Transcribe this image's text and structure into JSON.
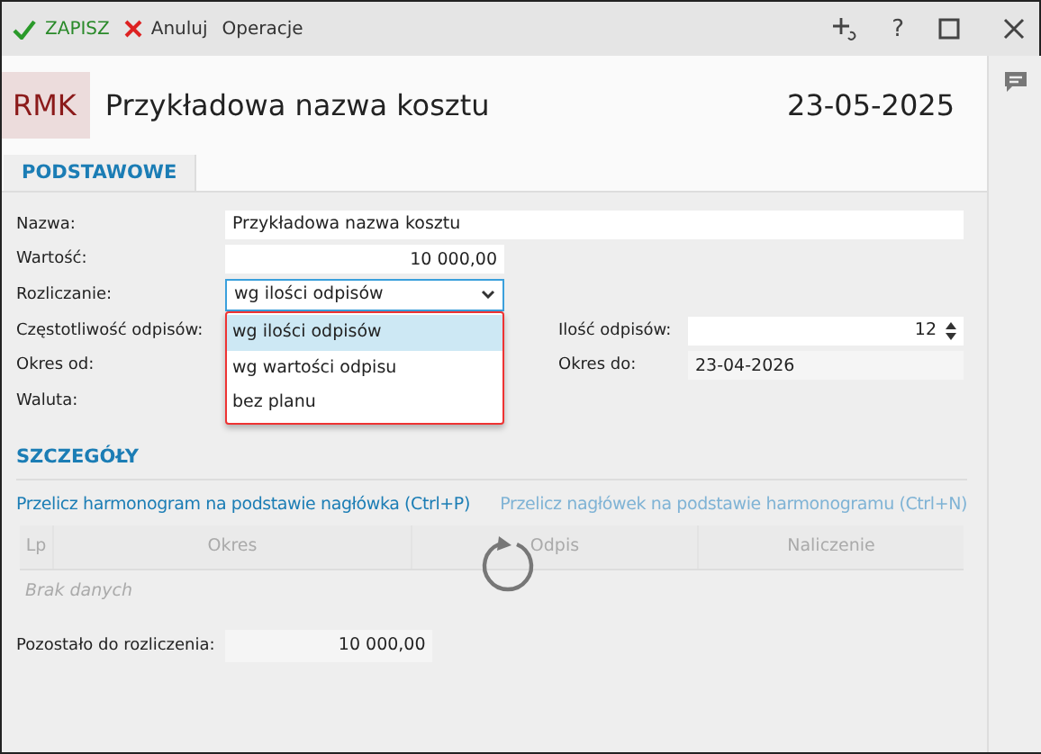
{
  "toolbar": {
    "actions": [
      {
        "kind": "save",
        "label": "ZAPISZ"
      },
      {
        "kind": "cancel",
        "label": "Anuluj"
      },
      {
        "kind": "menu",
        "label": "Operacje"
      }
    ],
    "help": "?"
  },
  "header": {
    "badge": "RMK",
    "title": "Przykładowa nazwa kosztu",
    "date": "23-05-2025"
  },
  "tabs": [
    {
      "label": "PODSTAWOWE",
      "selected": true
    }
  ],
  "form": {
    "left": [
      {
        "label": "Nazwa:",
        "kind": "text",
        "value": "Przykładowa nazwa kosztu"
      },
      {
        "label": "Wartość:",
        "kind": "number",
        "value": "10 000,00"
      },
      {
        "label": "Rozliczanie:",
        "kind": "select",
        "value": "wg ilości odpisów",
        "focused": true
      },
      {
        "label": "Częstotliwość odpisów:",
        "kind": "hidden"
      },
      {
        "label": "Okres od:",
        "kind": "hidden"
      },
      {
        "label": "Waluta:",
        "kind": "hidden"
      }
    ],
    "right": [
      {
        "label": "Ilość odpisów:",
        "kind": "spinner",
        "value": "12"
      },
      {
        "label": "Okres do:",
        "kind": "readonly",
        "value": "23-04-2026"
      }
    ],
    "dropdown": [
      {
        "label": "wg ilości odpisów",
        "selected": true
      },
      {
        "label": "wg wartości odpisu",
        "selected": false
      },
      {
        "label": "bez planu",
        "selected": false
      }
    ]
  },
  "details": {
    "title": "SZCZEGÓŁY",
    "links": [
      {
        "label": "Przelicz harmonogram na podstawie nagłówka (Ctrl+P)",
        "disabled": false
      },
      {
        "label": "Przelicz nagłówek na podstawie harmonogramu (Ctrl+N)",
        "disabled": true
      }
    ],
    "columns": [
      "Lp",
      "Okres",
      "Odpis",
      "Naliczenie"
    ],
    "empty": "Brak danych",
    "loading": true,
    "remaining": {
      "label": "Pozostało do rozliczenia:",
      "value": "10 000,00"
    }
  }
}
